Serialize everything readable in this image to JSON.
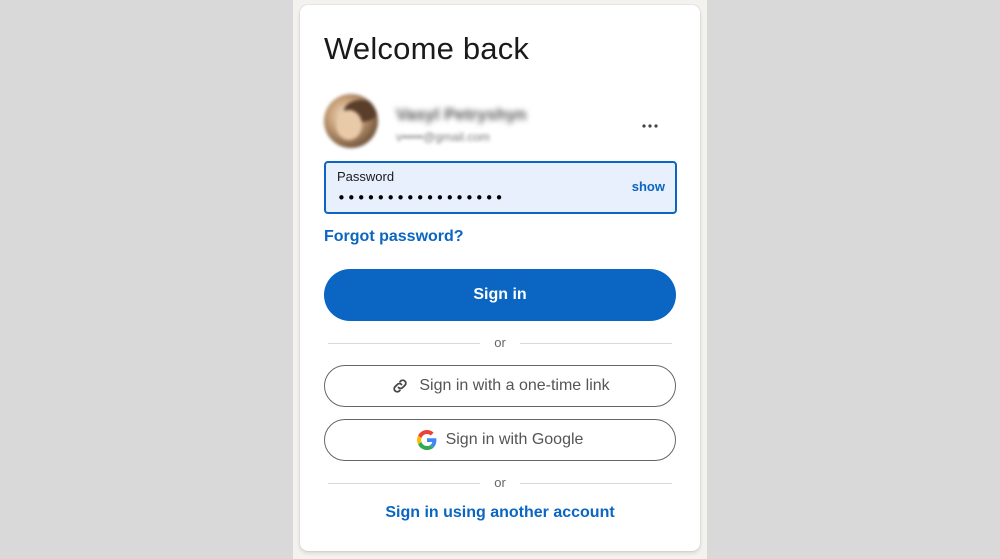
{
  "colors": {
    "accent": "#0a66c2",
    "background": "#d9d9d9",
    "card": "#ffffff",
    "input_fill": "#e8f0fe"
  },
  "title": "Welcome back",
  "account": {
    "name": "Vasyl Petryshyn",
    "email": "v•••••@gmail.com"
  },
  "password": {
    "label": "Password",
    "value": "•••••••••••••••••",
    "show_label": "show"
  },
  "links": {
    "forgot": "Forgot password?",
    "another_account": "Sign in using another account"
  },
  "buttons": {
    "sign_in": "Sign in",
    "one_time_link": "Sign in with a one-time link",
    "google": "Sign in with Google"
  },
  "dividers": {
    "or_1": "or",
    "or_2": "or"
  },
  "icons": {
    "more": "more-horizontal-icon",
    "link": "link-icon",
    "google": "google-logo-icon"
  }
}
